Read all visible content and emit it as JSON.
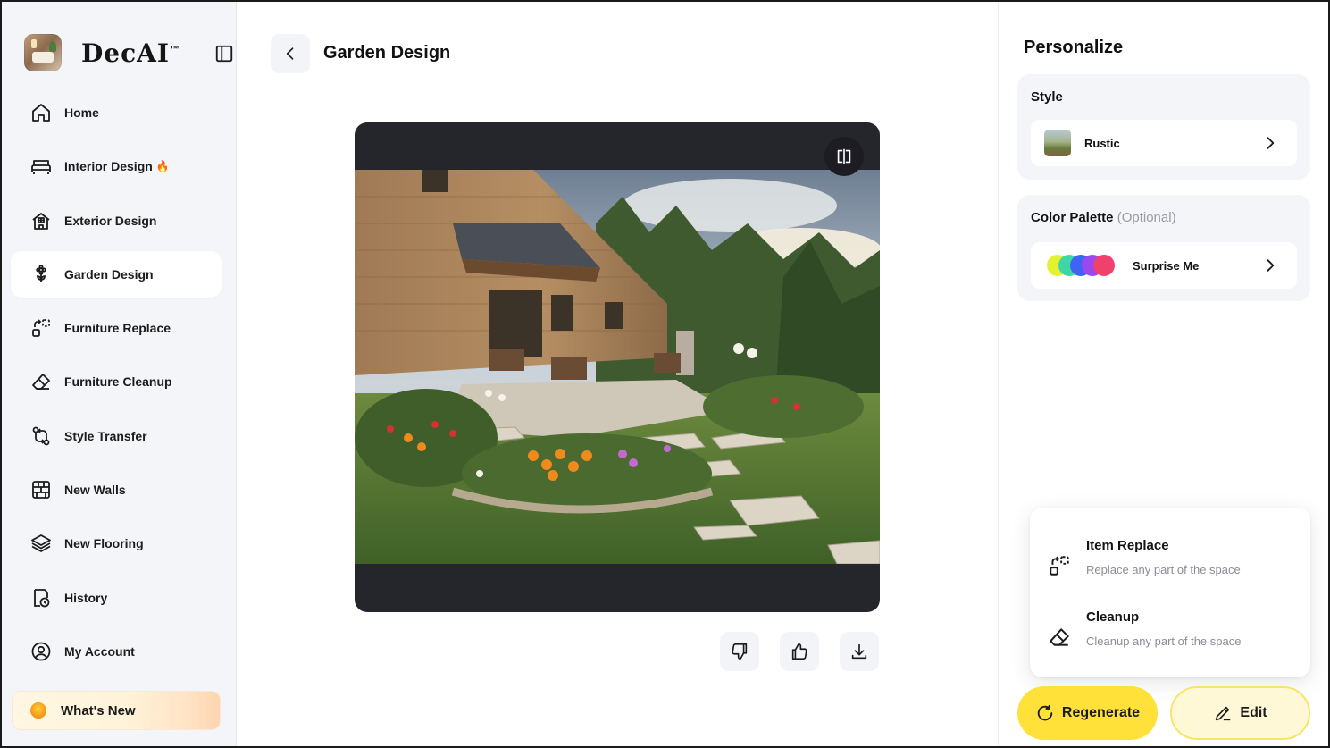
{
  "brand": {
    "name": "DecAI",
    "trademark": "™"
  },
  "sidebar": {
    "items": [
      {
        "label": "Home",
        "icon": "home-icon"
      },
      {
        "label": "Interior Design",
        "icon": "bed-icon",
        "badge": "🔥"
      },
      {
        "label": "Exterior Design",
        "icon": "house-icon"
      },
      {
        "label": "Garden Design",
        "icon": "flower-icon",
        "active": true
      },
      {
        "label": "Furniture Replace",
        "icon": "replace-icon"
      },
      {
        "label": "Furniture Cleanup",
        "icon": "eraser-icon"
      },
      {
        "label": "Style Transfer",
        "icon": "transfer-icon"
      },
      {
        "label": "New Walls",
        "icon": "brick-wall-icon"
      },
      {
        "label": "New Flooring",
        "icon": "layers-icon"
      },
      {
        "label": "History",
        "icon": "history-icon"
      },
      {
        "label": "My Account",
        "icon": "user-circle-icon"
      }
    ],
    "whats_new": "What's New"
  },
  "main": {
    "title": "Garden Design",
    "image_alt_icon": "compare-icon",
    "actions": [
      "thumbs-down-icon",
      "thumbs-up-icon",
      "download-icon"
    ]
  },
  "panel": {
    "title": "Personalize",
    "style": {
      "label": "Style",
      "value": "Rustic"
    },
    "palette": {
      "label": "Color Palette",
      "optional": "(Optional)",
      "value": "Surprise Me",
      "swatch_colors": [
        "#e8f22e",
        "#2ed4a8",
        "#3c5cf0",
        "#a43cf0",
        "#f03c6a"
      ]
    },
    "menu": [
      {
        "title": "Item Replace",
        "subtitle": "Replace any part of the space",
        "icon": "replace-icon"
      },
      {
        "title": "Cleanup",
        "subtitle": "Cleanup any part of the space",
        "icon": "eraser-icon"
      }
    ],
    "regenerate_label": "Regenerate",
    "edit_label": "Edit"
  },
  "colors": {
    "accent": "#ffe13a",
    "sidebar_bg": "#f4f5f9",
    "viewer_bg": "#25252c"
  }
}
